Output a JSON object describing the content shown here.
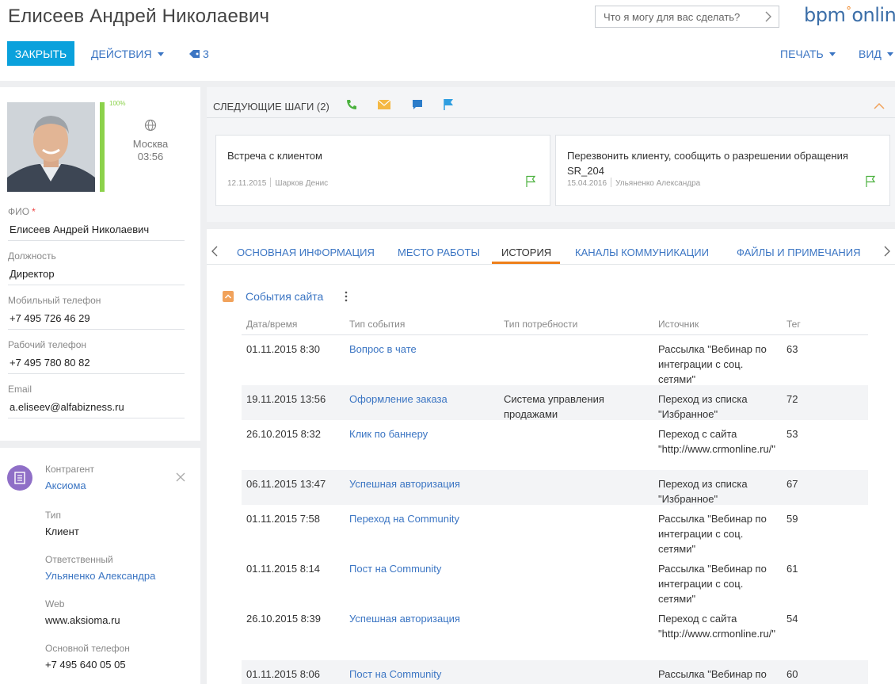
{
  "header": {
    "title": "Елисеев Андрей Николаевич",
    "search_placeholder": "Что я могу для вас сделать?",
    "logo": {
      "part1": "bpm",
      "part2": "online"
    },
    "close_label": "Закрыть",
    "actions_label": "Действия",
    "tags_count": "3",
    "print_label": "Печать",
    "view_label": "Вид"
  },
  "profile": {
    "completeness": "100%",
    "completeness_value": 100,
    "city": "Москва",
    "time": "03:56",
    "fields": [
      {
        "label": "ФИО",
        "required": "*",
        "value": "Елисеев Андрей Николаевич"
      },
      {
        "label": "Должность",
        "value": "Директор"
      },
      {
        "label": "Мобильный телефон",
        "value": "+7 495 726 46 29"
      },
      {
        "label": "Рабочий телефон",
        "value": "+7 495 780 80 82"
      },
      {
        "label": "Email",
        "value": "a.eliseev@alfabizness.ru"
      }
    ]
  },
  "account": {
    "account_label": "Контрагент",
    "account_value": "Аксиома",
    "type_label": "Тип",
    "type_value": "Клиент",
    "owner_label": "Ответственный",
    "owner_value": "Ульяненко Александра",
    "web_label": "Web",
    "web_value": "www.aksioma.ru",
    "phone_label": "Основной телефон",
    "phone_value": "+7 495 640 05 05"
  },
  "next_steps": {
    "title": "Следующие шаги (2)",
    "cards": [
      {
        "title": "Встреча с клиентом",
        "date": "12.11.2015",
        "owner": "Шарков Денис"
      },
      {
        "title": "Перезвонить клиенту, сообщить о разрешении обращения SR_204",
        "date": "15.04.2016",
        "owner": "Ульяненко Александра"
      }
    ]
  },
  "tabs": [
    {
      "label": "Основная информация"
    },
    {
      "label": "Место работы"
    },
    {
      "label": "История"
    },
    {
      "label": "Каналы коммуникации"
    },
    {
      "label": "Файлы и примечания"
    }
  ],
  "history": {
    "section_title": "События сайта",
    "columns": [
      "Дата/время",
      "Тип события",
      "Тип потребности",
      "Источник",
      "Тег"
    ],
    "rows": [
      {
        "date": "01.11.2015 8:30",
        "event": "Вопрос в чате",
        "need": "",
        "source": "Рассылка \"Вебинар по интеграции с соц. сетями\"",
        "tag": "63"
      },
      {
        "date": "19.11.2015 13:56",
        "event": "Оформление заказа",
        "need": "Система управления продажами",
        "source": "Переход из списка \"Избранное\"",
        "tag": "72"
      },
      {
        "date": "26.10.2015 8:32",
        "event": "Клик по баннеру",
        "need": "",
        "source": "Переход с сайта \"http://www.crmonline.ru/\"",
        "tag": "53"
      },
      {
        "date": "06.11.2015 13:47",
        "event": "Успешная авторизация",
        "need": "",
        "source": "Переход из списка \"Избранное\"",
        "tag": "67"
      },
      {
        "date": "01.11.2015 7:58",
        "event": "Переход на Community",
        "need": "",
        "source": "Рассылка \"Вебинар по интеграции с соц. сетями\"",
        "tag": "59"
      },
      {
        "date": "01.11.2015 8:14",
        "event": "Пост на Community",
        "need": "",
        "source": "Рассылка \"Вебинар по интеграции с соц. сетями\"",
        "tag": "61"
      },
      {
        "date": "26.10.2015 8:39",
        "event": "Успешная авторизация",
        "need": "",
        "source": "Переход с сайта \"http://www.crmonline.ru/\"",
        "tag": "54"
      },
      {
        "date": "01.11.2015 8:06",
        "event": "Пост на Community",
        "need": "",
        "source": "Рассылка \"Вебинар по",
        "tag": "60"
      }
    ]
  },
  "colors": {
    "accent": "#0aa1dc",
    "link": "#3b75c3",
    "active_tab": "#ee7f1a",
    "progress": "#8cd24b"
  }
}
